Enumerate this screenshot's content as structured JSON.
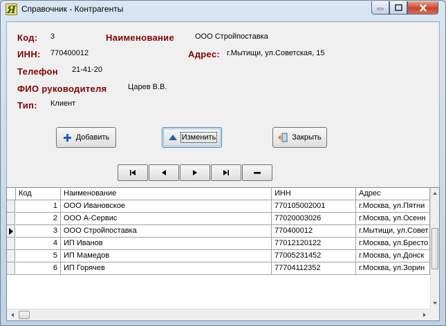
{
  "window": {
    "title": "Справочник - Контрагенты"
  },
  "fields": [
    {
      "label": "Код:",
      "value": "3"
    },
    {
      "label": "Наименование",
      "value": "ООО Стройпоставка"
    },
    {
      "label": "ИНН:",
      "value": "770400012"
    },
    {
      "label": "Адрес:",
      "value": "г.Мытищи, ул.Советская, 15"
    },
    {
      "label": "Телефон",
      "value": "21-41-20"
    },
    {
      "label": "ФИО руководителя",
      "value": "Царев В.В."
    },
    {
      "label": "Тип:",
      "value": "Клиент"
    }
  ],
  "buttons": {
    "add": "Добавить",
    "edit": "Изменить",
    "close": "Закрыть"
  },
  "grid": {
    "columns": [
      "Код",
      "Наименование",
      "ИНН",
      "Адрес"
    ],
    "current_row": 3,
    "rows": [
      [
        "1",
        "ООО Ивановское",
        "770105002001",
        "г.Москва, ул.Пятни"
      ],
      [
        "2",
        "ООО А-Сервис",
        "77020003026",
        "г.Москва, ул.Осенн"
      ],
      [
        "3",
        "ООО Стройпоставка",
        "770400012",
        "г.Мытищи, ул.Совет"
      ],
      [
        "4",
        "ИП Иванов",
        "77012120122",
        "г.Москва, ул.Бресто"
      ],
      [
        "5",
        "ИП Мамедов",
        "77005231452",
        "г.Москва, ул.Донск"
      ],
      [
        "6",
        "ИП Горячев",
        "77704112352",
        "г.Москва, ул.Зорин"
      ]
    ]
  },
  "colors": {
    "label": "#800000",
    "title_bar": "#c9d9ea",
    "close_button": "#c7452c"
  }
}
